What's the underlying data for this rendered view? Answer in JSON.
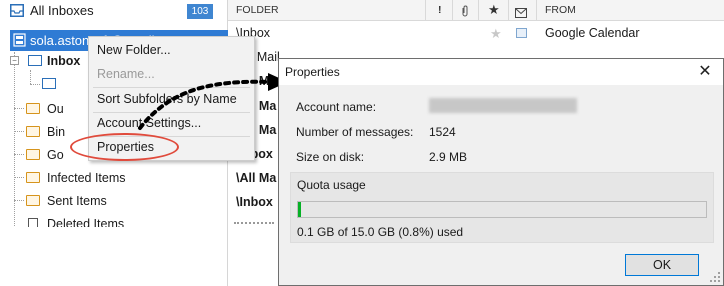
{
  "folder_pane": {
    "all_inboxes": {
      "label": "All Inboxes",
      "count": "103"
    },
    "account": {
      "label": "sola.astonsoft@gmail.com"
    },
    "folders": [
      {
        "label": "Inbox"
      },
      {
        "label": "Ou"
      },
      {
        "label": "Bin"
      },
      {
        "label": "Go"
      },
      {
        "label": "Infected Items"
      },
      {
        "label": "Sent Items"
      },
      {
        "label": "Deleted Items"
      }
    ]
  },
  "message_list": {
    "headers": {
      "folder": "FOLDER",
      "importance_icon": "!",
      "attachment_icon": "paperclip-icon",
      "flag_icon": "star-icon",
      "read_icon": "envelope-icon",
      "from": "FROM"
    },
    "rows": [
      {
        "folder": "\\Inbox",
        "from": "Google Calendar",
        "bold": false
      },
      {
        "folder": "\\All Mail",
        "from": "",
        "bold": false
      },
      {
        "folder": "\\All Ma",
        "from": "",
        "bold": true
      },
      {
        "folder": "\\All Ma",
        "from": "",
        "bold": true
      },
      {
        "folder": "\\All Ma",
        "from": "",
        "bold": true
      },
      {
        "folder": "\\Inbox",
        "from": "",
        "bold": true
      },
      {
        "folder": "\\All Ma",
        "from": "",
        "bold": true
      },
      {
        "folder": "\\Inbox",
        "from": "",
        "bold": true
      }
    ]
  },
  "context_menu": {
    "items": [
      {
        "label": "New Folder...",
        "disabled": false
      },
      {
        "label": "Rename...",
        "disabled": true
      },
      {
        "label": "Sort Subfolders by Name",
        "disabled": false
      },
      {
        "label": "Account Settings...",
        "disabled": false
      },
      {
        "label": "Properties",
        "disabled": false
      }
    ]
  },
  "properties_dialog": {
    "title": "Properties",
    "close_glyph": "✕",
    "account_name_label": "Account name:",
    "messages_label": "Number of messages:",
    "messages_value": "1524",
    "size_label": "Size on disk:",
    "size_value": "2.9 MB",
    "quota_title": "Quota usage",
    "quota_fraction": 0.008,
    "quota_text": "0.1 GB of 15.0 GB (0.8%) used",
    "ok_label": "OK"
  },
  "colors": {
    "accent": "#2f7bd4",
    "badge": "#3f86d1",
    "progress": "#06b025",
    "highlight": "#e04b3c"
  }
}
